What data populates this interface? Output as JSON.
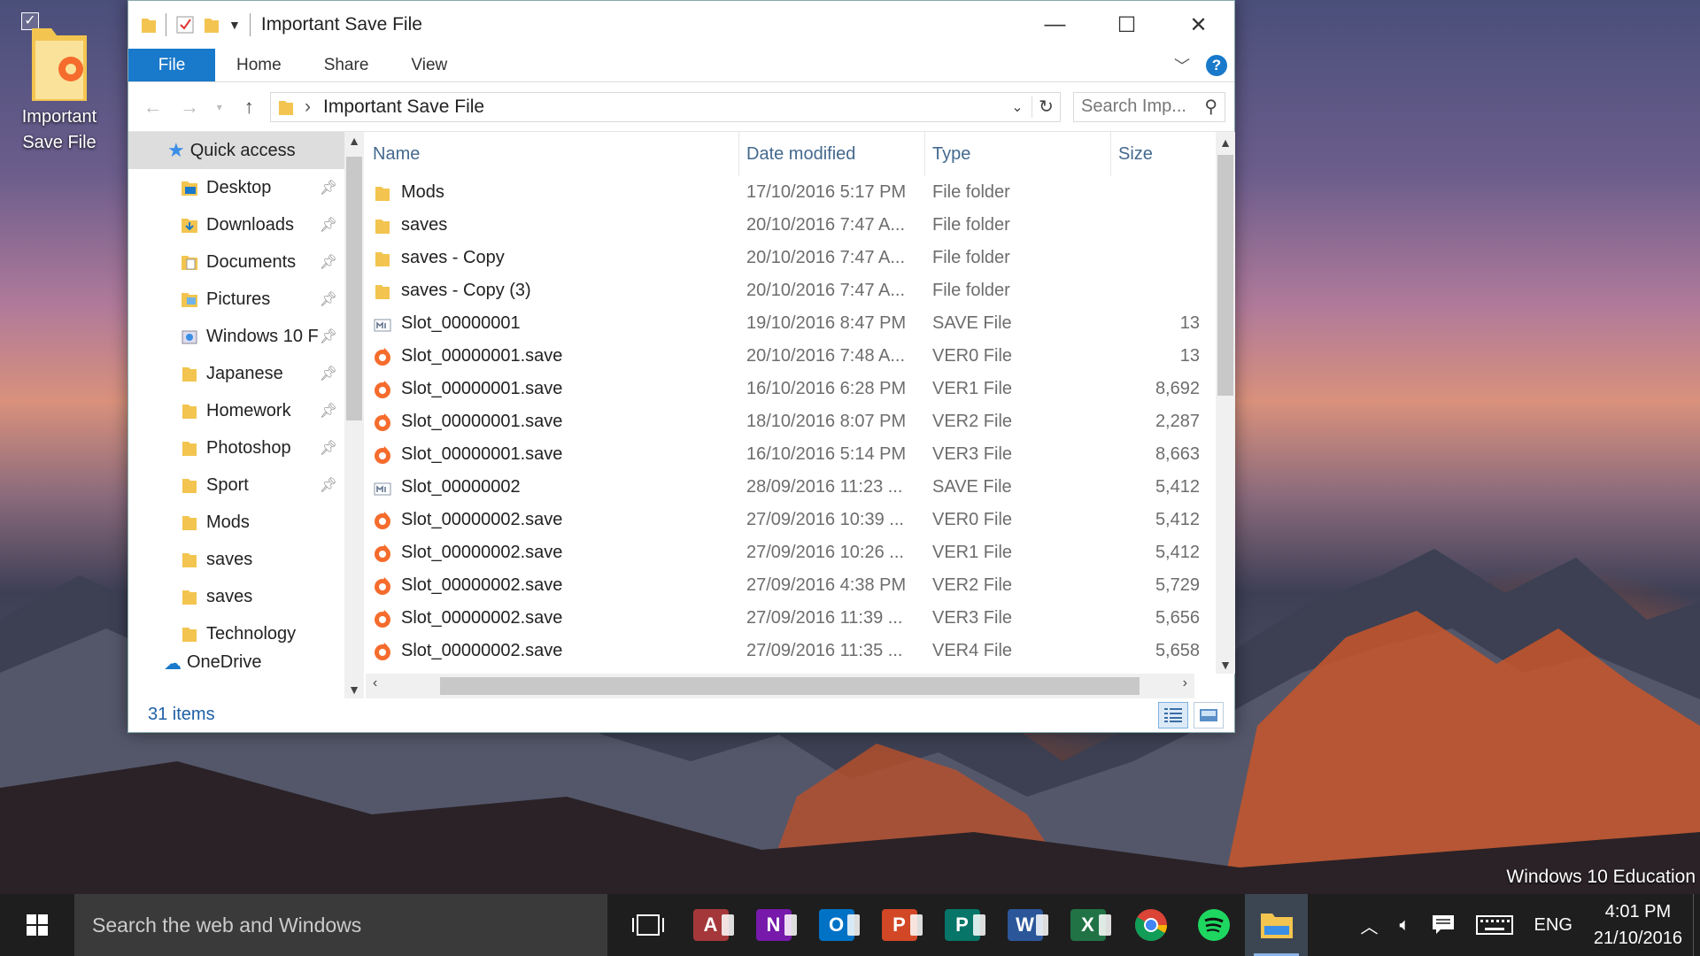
{
  "desktop": {
    "icon_label_line1": "Important",
    "icon_label_line2": "Save File",
    "watermark": "Windows 10 Education"
  },
  "window": {
    "title": "Important Save File",
    "controls": {
      "minimize": "—",
      "maximize": "☐",
      "close": "✕"
    },
    "ribbon_tabs": [
      "File",
      "Home",
      "Share",
      "View"
    ],
    "help": "?",
    "address": {
      "path": "Important Save File"
    },
    "search": {
      "placeholder": "Search Imp..."
    },
    "nav": {
      "quick_access": "Quick access",
      "items": [
        {
          "label": "Desktop",
          "pinned": true,
          "icon": "desktop-folder-icon"
        },
        {
          "label": "Downloads",
          "pinned": true,
          "icon": "downloads-folder-icon"
        },
        {
          "label": "Documents",
          "pinned": true,
          "icon": "documents-folder-icon"
        },
        {
          "label": "Pictures",
          "pinned": true,
          "icon": "pictures-folder-icon"
        },
        {
          "label": "Windows 10 F",
          "pinned": true,
          "icon": "drive-folder-icon"
        },
        {
          "label": "Japanese",
          "pinned": true,
          "icon": "folder-icon"
        },
        {
          "label": "Homework",
          "pinned": true,
          "icon": "folder-icon"
        },
        {
          "label": "Photoshop",
          "pinned": true,
          "icon": "folder-icon"
        },
        {
          "label": "Sport",
          "pinned": true,
          "icon": "folder-icon"
        },
        {
          "label": "Mods",
          "pinned": false,
          "icon": "folder-icon"
        },
        {
          "label": "saves",
          "pinned": false,
          "icon": "folder-icon"
        },
        {
          "label": "saves",
          "pinned": false,
          "icon": "folder-icon"
        },
        {
          "label": "Technology",
          "pinned": false,
          "icon": "folder-icon"
        }
      ],
      "onedrive": "OneDrive"
    },
    "columns": {
      "name": "Name",
      "date": "Date modified",
      "type": "Type",
      "size": "Size"
    },
    "files": [
      {
        "name": "Mods",
        "date": "17/10/2016 5:17 PM",
        "type": "File folder",
        "size": "",
        "icon": "folder-icon"
      },
      {
        "name": "saves",
        "date": "20/10/2016 7:47 A...",
        "type": "File folder",
        "size": "",
        "icon": "folder-icon"
      },
      {
        "name": "saves - Copy",
        "date": "20/10/2016 7:47 A...",
        "type": "File folder",
        "size": "",
        "icon": "folder-icon"
      },
      {
        "name": "saves - Copy (3)",
        "date": "20/10/2016 7:47 A...",
        "type": "File folder",
        "size": "",
        "icon": "folder-icon"
      },
      {
        "name": "Slot_00000001",
        "date": "19/10/2016 8:47 PM",
        "type": "SAVE File",
        "size": "13",
        "icon": "generic-file-icon"
      },
      {
        "name": "Slot_00000001.save",
        "date": "20/10/2016 7:48 A...",
        "type": "VER0 File",
        "size": "13",
        "icon": "origin-file-icon"
      },
      {
        "name": "Slot_00000001.save",
        "date": "16/10/2016 6:28 PM",
        "type": "VER1 File",
        "size": "8,692",
        "icon": "origin-file-icon"
      },
      {
        "name": "Slot_00000001.save",
        "date": "18/10/2016 8:07 PM",
        "type": "VER2 File",
        "size": "2,287",
        "icon": "origin-file-icon"
      },
      {
        "name": "Slot_00000001.save",
        "date": "16/10/2016 5:14 PM",
        "type": "VER3 File",
        "size": "8,663",
        "icon": "origin-file-icon"
      },
      {
        "name": "Slot_00000002",
        "date": "28/09/2016 11:23 ...",
        "type": "SAVE File",
        "size": "5,412",
        "icon": "generic-file-icon"
      },
      {
        "name": "Slot_00000002.save",
        "date": "27/09/2016 10:39 ...",
        "type": "VER0 File",
        "size": "5,412",
        "icon": "origin-file-icon"
      },
      {
        "name": "Slot_00000002.save",
        "date": "27/09/2016 10:26 ...",
        "type": "VER1 File",
        "size": "5,412",
        "icon": "origin-file-icon"
      },
      {
        "name": "Slot_00000002.save",
        "date": "27/09/2016 4:38 PM",
        "type": "VER2 File",
        "size": "5,729",
        "icon": "origin-file-icon"
      },
      {
        "name": "Slot_00000002.save",
        "date": "27/09/2016 11:39 ...",
        "type": "VER3 File",
        "size": "5,656",
        "icon": "origin-file-icon"
      },
      {
        "name": "Slot_00000002.save",
        "date": "27/09/2016 11:35 ...",
        "type": "VER4 File",
        "size": "5,658",
        "icon": "origin-file-icon"
      }
    ],
    "status": "31 items"
  },
  "taskbar": {
    "search_placeholder": "Search the web and Windows",
    "apps": [
      {
        "name": "task-view-icon"
      },
      {
        "name": "access-icon",
        "letter": "A",
        "color": "#a4373a"
      },
      {
        "name": "onenote-icon",
        "letter": "N",
        "color": "#7719aa"
      },
      {
        "name": "outlook-icon",
        "letter": "O",
        "color": "#0072c6"
      },
      {
        "name": "powerpoint-icon",
        "letter": "P",
        "color": "#d24726"
      },
      {
        "name": "publisher-icon",
        "letter": "P",
        "color": "#077568"
      },
      {
        "name": "word-icon",
        "letter": "W",
        "color": "#2b579a"
      },
      {
        "name": "excel-icon",
        "letter": "X",
        "color": "#217346"
      },
      {
        "name": "chrome-icon"
      },
      {
        "name": "spotify-icon"
      },
      {
        "name": "file-explorer-icon"
      }
    ],
    "language": "ENG",
    "time": "4:01 PM",
    "date": "21/10/2016"
  },
  "colors": {
    "accent": "#1979ca",
    "folder": "#f8d775",
    "origin": "#f56c2d"
  }
}
